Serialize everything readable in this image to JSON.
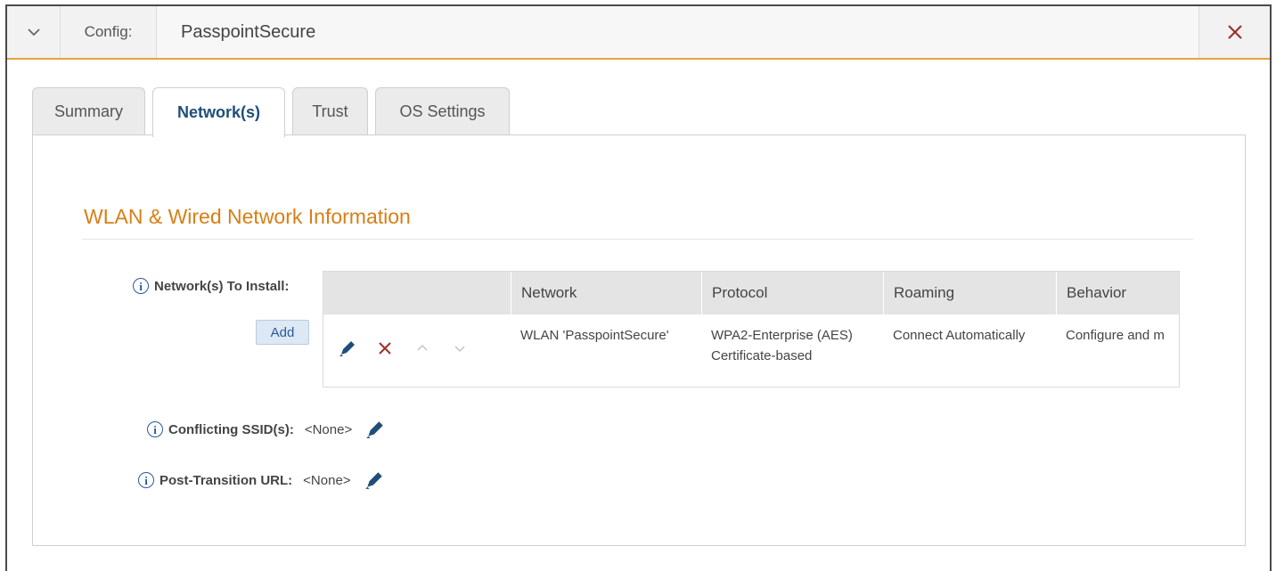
{
  "header": {
    "config_label": "Config:",
    "config_value": "PasspointSecure"
  },
  "tabs": [
    {
      "label": "Summary",
      "active": false
    },
    {
      "label": "Network(s)",
      "active": true
    },
    {
      "label": "Trust",
      "active": false
    },
    {
      "label": "OS Settings",
      "active": false
    }
  ],
  "section": {
    "title": "WLAN & Wired Network Information"
  },
  "networks": {
    "label": "Network(s) To Install:",
    "add_label": "Add",
    "columns": [
      "Network",
      "Protocol",
      "Roaming",
      "Behavior"
    ],
    "rows": [
      {
        "network": "WLAN 'PasspointSecure'",
        "protocol": "WPA2-Enterprise (AES)",
        "protocol_sub": "Certificate-based",
        "roaming": "Connect Automatically",
        "behavior": "Configure and m"
      }
    ]
  },
  "conflicting": {
    "label": "Conflicting SSID(s):",
    "value": "<None>"
  },
  "post_transition": {
    "label": "Post-Transition URL:",
    "value": "<None>"
  },
  "colors": {
    "accent": "#e8a33d",
    "section_title": "#d97e16",
    "link_blue": "#1f4e79",
    "delete_red": "#a0302a"
  },
  "icons": {
    "collapse": "chevron-down-icon",
    "close": "close-icon",
    "info": "info-icon",
    "edit": "pencil-icon",
    "delete": "close-icon",
    "move_up": "chevron-up-icon",
    "move_down": "chevron-down-icon"
  }
}
